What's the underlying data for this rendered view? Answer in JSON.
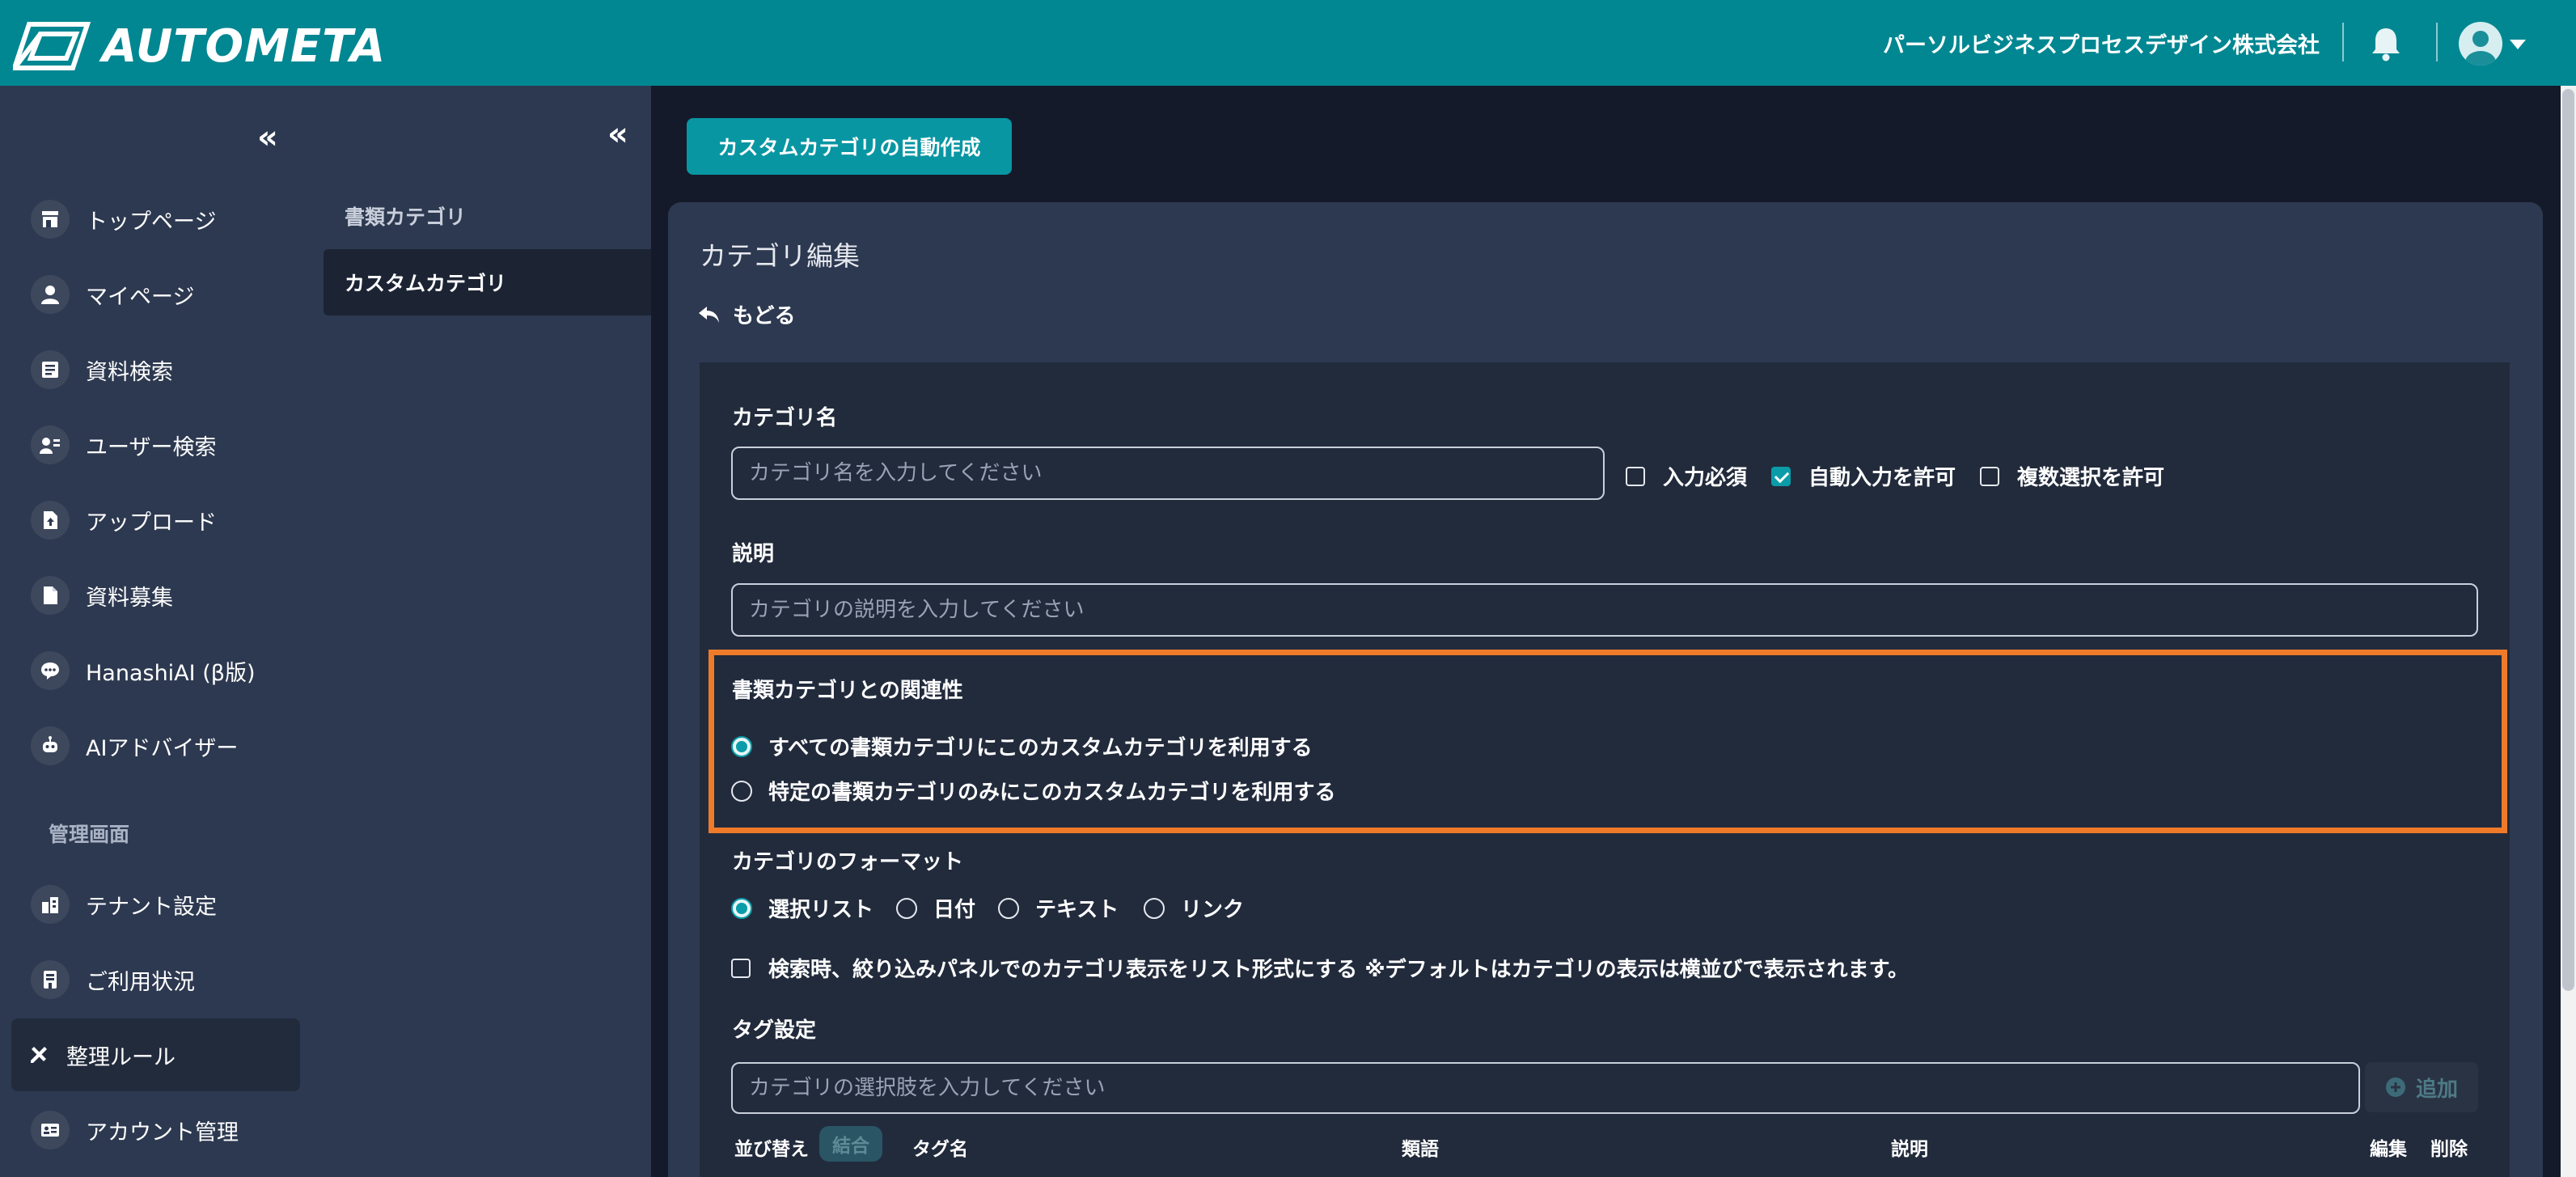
{
  "app": {
    "logo_text": "AUTOMETA",
    "company": "パーソルビジネスプロセスデザイン株式会社",
    "brand_color": "#008792",
    "accent_color": "#0996a3",
    "highlight_color": "#ef7a2a"
  },
  "sidebar": {
    "collapse_icon": "«",
    "items": [
      {
        "label": "トップページ",
        "icon": "store-icon"
      },
      {
        "label": "マイページ",
        "icon": "person-icon"
      },
      {
        "label": "資料検索",
        "icon": "document-search-icon"
      },
      {
        "label": "ユーザー検索",
        "icon": "user-search-icon"
      },
      {
        "label": "アップロード",
        "icon": "upload-file-icon"
      },
      {
        "label": "資料募集",
        "icon": "file-icon"
      },
      {
        "label": "HanashiAI (β版)",
        "icon": "chat-icon"
      },
      {
        "label": "AIアドバイザー",
        "icon": "robot-icon"
      }
    ],
    "section_label": "管理画面",
    "admin_items": [
      {
        "label": "テナント設定",
        "icon": "building-icon"
      },
      {
        "label": "ご利用状況",
        "icon": "receipt-icon"
      },
      {
        "label": "整理ルール",
        "icon": "tools-icon",
        "active": true
      },
      {
        "label": "アカウント管理",
        "icon": "id-card-icon"
      }
    ]
  },
  "subnav": {
    "collapse_icon": "«",
    "items": [
      {
        "label": "書類カテゴリ"
      },
      {
        "label": "カスタムカテゴリ",
        "active": true
      }
    ]
  },
  "main": {
    "auto_create_button": "カスタムカテゴリの自動作成",
    "card_title": "カテゴリ編集",
    "back_label": "もどる",
    "category_name": {
      "label": "カテゴリ名",
      "placeholder": "カテゴリ名を入力してください",
      "value": ""
    },
    "checkboxes": [
      {
        "label": "入力必須",
        "checked": false
      },
      {
        "label": "自動入力を許可",
        "checked": true
      },
      {
        "label": "複数選択を許可",
        "checked": false
      }
    ],
    "description": {
      "label": "説明",
      "placeholder": "カテゴリの説明を入力してください",
      "value": ""
    },
    "relation": {
      "label": "書類カテゴリとの関連性",
      "options": [
        {
          "label": "すべての書類カテゴリにこのカスタムカテゴリを利用する",
          "selected": true
        },
        {
          "label": "特定の書類カテゴリのみにこのカスタムカテゴリを利用する",
          "selected": false
        }
      ]
    },
    "format": {
      "label": "カテゴリのフォーマット",
      "options": [
        {
          "label": "選択リスト",
          "selected": true
        },
        {
          "label": "日付",
          "selected": false
        },
        {
          "label": "テキスト",
          "selected": false
        },
        {
          "label": "リンク",
          "selected": false
        }
      ]
    },
    "list_display": {
      "label": "検索時、絞り込みパネルでのカテゴリ表示をリスト形式にする ※デフォルトはカテゴリの表示は横並びで表示されます。",
      "checked": false
    },
    "tags": {
      "label": "タグ設定",
      "placeholder": "カテゴリの選択肢を入力してください",
      "value": "",
      "add_button": "追加"
    },
    "table": {
      "sort_label": "並び替え",
      "merge_button": "結合",
      "columns": [
        "タグ名",
        "類語",
        "説明",
        "編集",
        "削除"
      ]
    }
  }
}
